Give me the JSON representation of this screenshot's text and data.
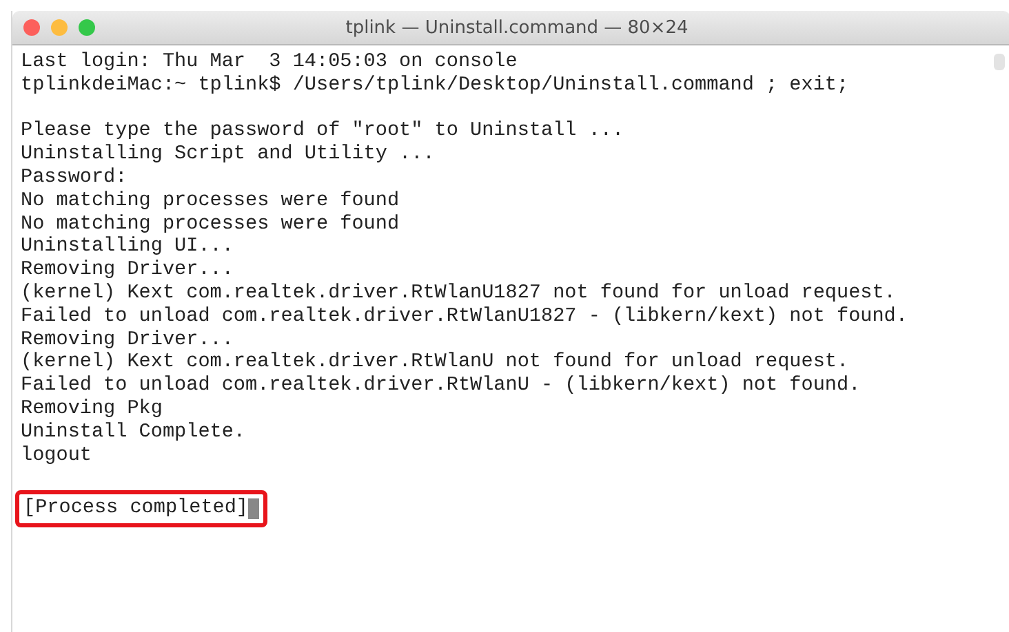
{
  "window": {
    "title": "tplink — Uninstall.command — 80×24"
  },
  "terminal": {
    "blocks": [
      [
        "Last login: Thu Mar  3 14:05:03 on console",
        "tplinkdeiMac:~ tplink$ /Users/tplink/Desktop/Uninstall.command ; exit;"
      ],
      [
        "Please type the password of \"root\" to Uninstall ...",
        "Uninstalling Script and Utility ...",
        "Password:",
        "No matching processes were found",
        "No matching processes were found",
        "Uninstalling UI...",
        "Removing Driver...",
        "(kernel) Kext com.realtek.driver.RtWlanU1827 not found for unload request.",
        "Failed to unload com.realtek.driver.RtWlanU1827 - (libkern/kext) not found.",
        "Removing Driver...",
        "(kernel) Kext com.realtek.driver.RtWlanU not found for unload request.",
        "Failed to unload com.realtek.driver.RtWlanU - (libkern/kext) not found.",
        "Removing Pkg",
        "Uninstall Complete.",
        "logout"
      ]
    ],
    "status": {
      "text": "[Process completed]",
      "highlighted": true
    }
  }
}
